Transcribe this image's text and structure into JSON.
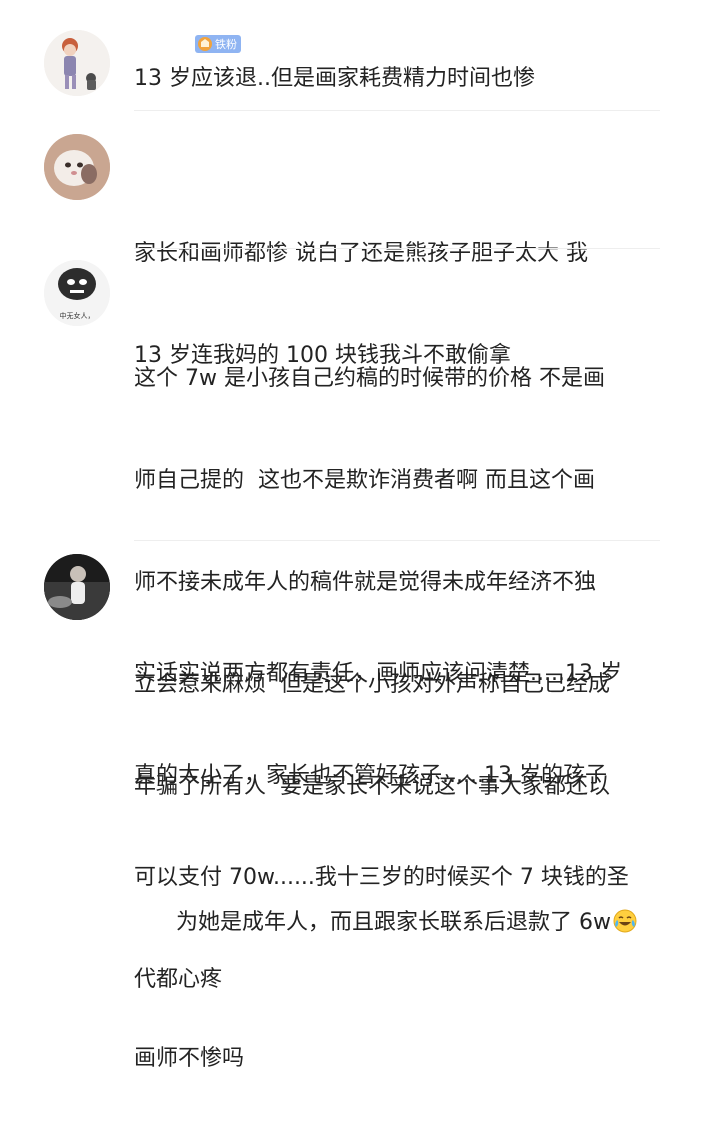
{
  "comments": [
    {
      "username": "",
      "badge": "铁粉",
      "text": "13 岁应该退..但是画家耗费精力时间也惨"
    },
    {
      "username": "",
      "text_lines": [
        "家长和画师都惨 说白了还是熊孩子胆子太大 我",
        "13 岁连我妈的 100 块钱我斗不敢偷拿"
      ]
    },
    {
      "username": "",
      "avatar_caption": "中无女人，",
      "text_lines": [
        "这个 7w 是小孩自己约稿的时候带的价格 不是画",
        "师自己提的  这也不是欺诈消费者啊 而且这个画",
        "师不接未成年人的稿件就是觉得未成年经济不独",
        "立会惹来麻烦  但是这个小孩对外声称自己已经成",
        "年骗了所有人  要是家长不来说这个事大家都还以",
        "为她是成年人，而且跟家长联系后退款了 6w",
        "画师不惨吗"
      ],
      "emoji": "laugh-cry-emoji"
    },
    {
      "username": "",
      "text_lines": [
        "实话实说两方都有责任，画师应该问清楚.....13 岁",
        "真的太小了，家长也不管好孩子......13 岁的孩子",
        "可以支付 70w......我十三岁的时候买个 7 块钱的圣",
        "代都心疼"
      ]
    }
  ],
  "colors": {
    "text": "#232323",
    "badge_bg": "#8fb4f2",
    "divider": "#eeeeee"
  }
}
